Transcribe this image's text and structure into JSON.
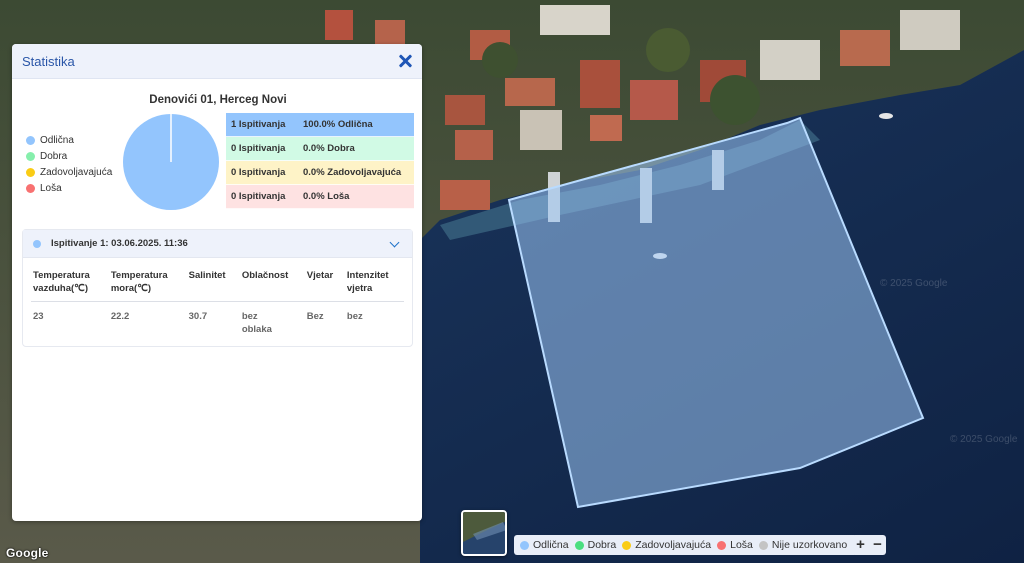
{
  "panel": {
    "title": "Statistika",
    "location": "Denovići 01, Herceg Novi",
    "legend": [
      {
        "label": "Odlična",
        "color": "#93c5fd"
      },
      {
        "label": "Dobra",
        "color": "#86efac"
      },
      {
        "label": "Zadovoljavajuća",
        "color": "#facc15"
      },
      {
        "label": "Loša",
        "color": "#f87171"
      }
    ],
    "stats": [
      {
        "count": "1 Ispitivanja",
        "percent": "100.0% Odlična",
        "bg": "#93c5fd"
      },
      {
        "count": "0 Ispitivanja",
        "percent": "0.0% Dobra",
        "bg": "#d1fae5"
      },
      {
        "count": "0 Ispitivanja",
        "percent": "0.0% Zadovoljavajuća",
        "bg": "#fef3c7"
      },
      {
        "count": "0 Ispitivanja",
        "percent": "0.0% Loša",
        "bg": "#fee2e2"
      }
    ],
    "pie": {
      "values": [
        1,
        0,
        0,
        0
      ],
      "colors": [
        "#93c5fd",
        "#86efac",
        "#facc15",
        "#f87171"
      ]
    },
    "measurement": {
      "title": "Ispitivanje 1: 03.06.2025. 11:36",
      "dot_color": "#93c5fd",
      "headers": [
        [
          "Temperatura",
          "vazduha(℃)"
        ],
        [
          "Temperatura",
          "mora(℃)"
        ],
        [
          "Salinitet"
        ],
        [
          "Oblačnost"
        ],
        [
          "Vjetar"
        ],
        [
          "Intenzitet",
          "vjetra"
        ]
      ],
      "values": [
        [
          "23"
        ],
        [
          "22.2"
        ],
        [
          "30.7"
        ],
        [
          "bez",
          "oblaka"
        ],
        [
          "Bez"
        ],
        [
          "bez"
        ]
      ]
    }
  },
  "map": {
    "legend": [
      {
        "label": "Odlična",
        "color": "#93c5fd"
      },
      {
        "label": "Dobra",
        "color": "#4ade80"
      },
      {
        "label": "Zadovoljavajuća",
        "color": "#facc15"
      },
      {
        "label": "Loša",
        "color": "#f87171"
      },
      {
        "label": "Nije uzorkovano",
        "color": "#c4c4c4"
      }
    ],
    "zoom_in": "+",
    "zoom_out": "−",
    "google_logo": "Google",
    "watermark": "© 2025 Google"
  }
}
